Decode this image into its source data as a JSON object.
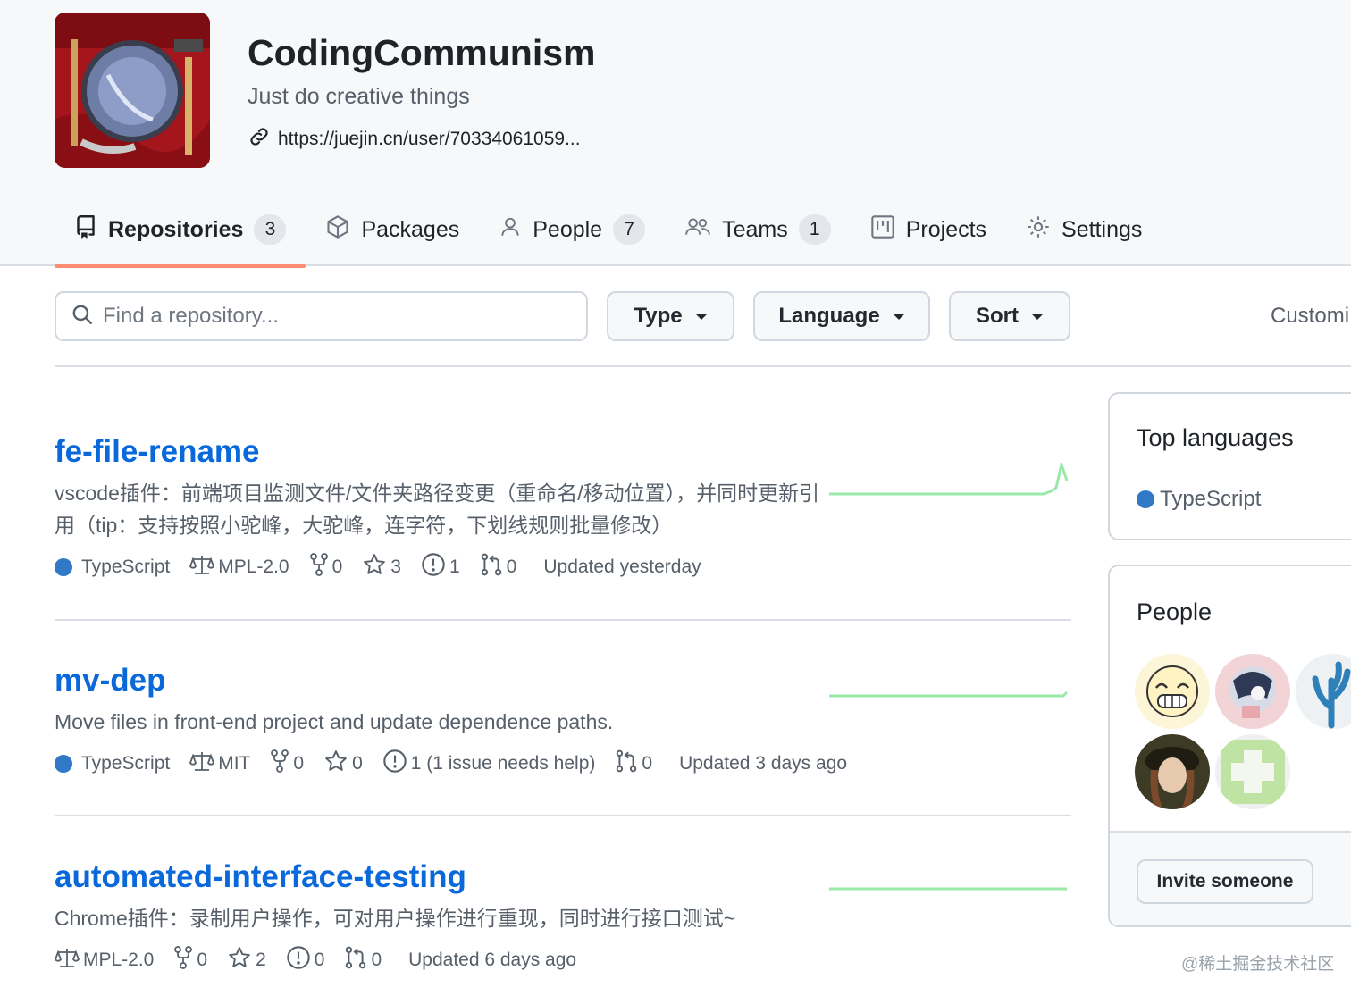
{
  "org": {
    "name": "CodingCommunism",
    "description": "Just do creative things",
    "link": "https://juejin.cn/user/70334061059..."
  },
  "tabs": [
    {
      "label": "Repositories",
      "count": "3",
      "icon": "repo-icon",
      "active": true
    },
    {
      "label": "Packages",
      "count": "",
      "icon": "package-icon"
    },
    {
      "label": "People",
      "count": "7",
      "icon": "person-icon"
    },
    {
      "label": "Teams",
      "count": "1",
      "icon": "people-icon"
    },
    {
      "label": "Projects",
      "count": "",
      "icon": "project-icon"
    },
    {
      "label": "Settings",
      "count": "",
      "icon": "gear-icon"
    }
  ],
  "filters": {
    "search_placeholder": "Find a repository...",
    "type_label": "Type",
    "language_label": "Language",
    "sort_label": "Sort",
    "customize_label": "Customi"
  },
  "repos": [
    {
      "name": "fe-file-rename",
      "description": "vscode插件：前端项目监测文件/文件夹路径变更（重命名/移动位置），并同时更新引用（tip：支持按照小驼峰，大驼峰，连字符，下划线规则批量修改）",
      "language": "TypeScript",
      "license": "MPL-2.0",
      "forks": "0",
      "stars": "3",
      "issues": "1",
      "pulls": "0",
      "updated": "Updated yesterday"
    },
    {
      "name": "mv-dep",
      "description": "Move files in front-end project and update dependence paths.",
      "language": "TypeScript",
      "license": "MIT",
      "forks": "0",
      "stars": "0",
      "issues": "1 (1 issue needs help)",
      "pulls": "0",
      "updated": "Updated 3 days ago"
    },
    {
      "name": "automated-interface-testing",
      "description": "Chrome插件：录制用户操作，可对用户操作进行重现，同时进行接口测试~",
      "language": "",
      "license": "MPL-2.0",
      "forks": "0",
      "stars": "2",
      "issues": "0",
      "pulls": "0",
      "updated": "Updated 6 days ago"
    }
  ],
  "sidebar": {
    "top_languages_title": "Top languages",
    "top_language": "TypeScript",
    "people_title": "People",
    "invite_label": "Invite someone"
  },
  "colors": {
    "link": "#0969da",
    "typescript": "#3178c6",
    "tab_underline": "#fd8c73",
    "sparkline": "#9be9a8"
  },
  "watermark": "@稀土掘金技术社区"
}
